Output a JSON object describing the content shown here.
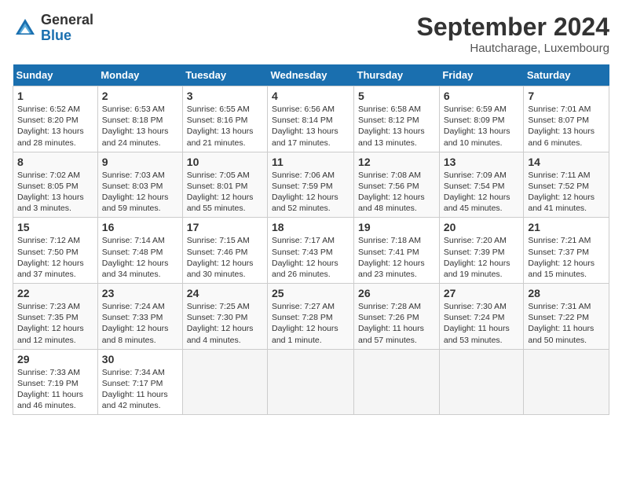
{
  "header": {
    "logo_general": "General",
    "logo_blue": "Blue",
    "month_title": "September 2024",
    "location": "Hautcharage, Luxembourg"
  },
  "columns": [
    "Sunday",
    "Monday",
    "Tuesday",
    "Wednesday",
    "Thursday",
    "Friday",
    "Saturday"
  ],
  "weeks": [
    [
      {
        "day": "1",
        "info": "Sunrise: 6:52 AM\nSunset: 8:20 PM\nDaylight: 13 hours\nand 28 minutes."
      },
      {
        "day": "2",
        "info": "Sunrise: 6:53 AM\nSunset: 8:18 PM\nDaylight: 13 hours\nand 24 minutes."
      },
      {
        "day": "3",
        "info": "Sunrise: 6:55 AM\nSunset: 8:16 PM\nDaylight: 13 hours\nand 21 minutes."
      },
      {
        "day": "4",
        "info": "Sunrise: 6:56 AM\nSunset: 8:14 PM\nDaylight: 13 hours\nand 17 minutes."
      },
      {
        "day": "5",
        "info": "Sunrise: 6:58 AM\nSunset: 8:12 PM\nDaylight: 13 hours\nand 13 minutes."
      },
      {
        "day": "6",
        "info": "Sunrise: 6:59 AM\nSunset: 8:09 PM\nDaylight: 13 hours\nand 10 minutes."
      },
      {
        "day": "7",
        "info": "Sunrise: 7:01 AM\nSunset: 8:07 PM\nDaylight: 13 hours\nand 6 minutes."
      }
    ],
    [
      {
        "day": "8",
        "info": "Sunrise: 7:02 AM\nSunset: 8:05 PM\nDaylight: 13 hours\nand 3 minutes."
      },
      {
        "day": "9",
        "info": "Sunrise: 7:03 AM\nSunset: 8:03 PM\nDaylight: 12 hours\nand 59 minutes."
      },
      {
        "day": "10",
        "info": "Sunrise: 7:05 AM\nSunset: 8:01 PM\nDaylight: 12 hours\nand 55 minutes."
      },
      {
        "day": "11",
        "info": "Sunrise: 7:06 AM\nSunset: 7:59 PM\nDaylight: 12 hours\nand 52 minutes."
      },
      {
        "day": "12",
        "info": "Sunrise: 7:08 AM\nSunset: 7:56 PM\nDaylight: 12 hours\nand 48 minutes."
      },
      {
        "day": "13",
        "info": "Sunrise: 7:09 AM\nSunset: 7:54 PM\nDaylight: 12 hours\nand 45 minutes."
      },
      {
        "day": "14",
        "info": "Sunrise: 7:11 AM\nSunset: 7:52 PM\nDaylight: 12 hours\nand 41 minutes."
      }
    ],
    [
      {
        "day": "15",
        "info": "Sunrise: 7:12 AM\nSunset: 7:50 PM\nDaylight: 12 hours\nand 37 minutes."
      },
      {
        "day": "16",
        "info": "Sunrise: 7:14 AM\nSunset: 7:48 PM\nDaylight: 12 hours\nand 34 minutes."
      },
      {
        "day": "17",
        "info": "Sunrise: 7:15 AM\nSunset: 7:46 PM\nDaylight: 12 hours\nand 30 minutes."
      },
      {
        "day": "18",
        "info": "Sunrise: 7:17 AM\nSunset: 7:43 PM\nDaylight: 12 hours\nand 26 minutes."
      },
      {
        "day": "19",
        "info": "Sunrise: 7:18 AM\nSunset: 7:41 PM\nDaylight: 12 hours\nand 23 minutes."
      },
      {
        "day": "20",
        "info": "Sunrise: 7:20 AM\nSunset: 7:39 PM\nDaylight: 12 hours\nand 19 minutes."
      },
      {
        "day": "21",
        "info": "Sunrise: 7:21 AM\nSunset: 7:37 PM\nDaylight: 12 hours\nand 15 minutes."
      }
    ],
    [
      {
        "day": "22",
        "info": "Sunrise: 7:23 AM\nSunset: 7:35 PM\nDaylight: 12 hours\nand 12 minutes."
      },
      {
        "day": "23",
        "info": "Sunrise: 7:24 AM\nSunset: 7:33 PM\nDaylight: 12 hours\nand 8 minutes."
      },
      {
        "day": "24",
        "info": "Sunrise: 7:25 AM\nSunset: 7:30 PM\nDaylight: 12 hours\nand 4 minutes."
      },
      {
        "day": "25",
        "info": "Sunrise: 7:27 AM\nSunset: 7:28 PM\nDaylight: 12 hours\nand 1 minute."
      },
      {
        "day": "26",
        "info": "Sunrise: 7:28 AM\nSunset: 7:26 PM\nDaylight: 11 hours\nand 57 minutes."
      },
      {
        "day": "27",
        "info": "Sunrise: 7:30 AM\nSunset: 7:24 PM\nDaylight: 11 hours\nand 53 minutes."
      },
      {
        "day": "28",
        "info": "Sunrise: 7:31 AM\nSunset: 7:22 PM\nDaylight: 11 hours\nand 50 minutes."
      }
    ],
    [
      {
        "day": "29",
        "info": "Sunrise: 7:33 AM\nSunset: 7:19 PM\nDaylight: 11 hours\nand 46 minutes."
      },
      {
        "day": "30",
        "info": "Sunrise: 7:34 AM\nSunset: 7:17 PM\nDaylight: 11 hours\nand 42 minutes."
      },
      {
        "day": "",
        "info": ""
      },
      {
        "day": "",
        "info": ""
      },
      {
        "day": "",
        "info": ""
      },
      {
        "day": "",
        "info": ""
      },
      {
        "day": "",
        "info": ""
      }
    ]
  ]
}
